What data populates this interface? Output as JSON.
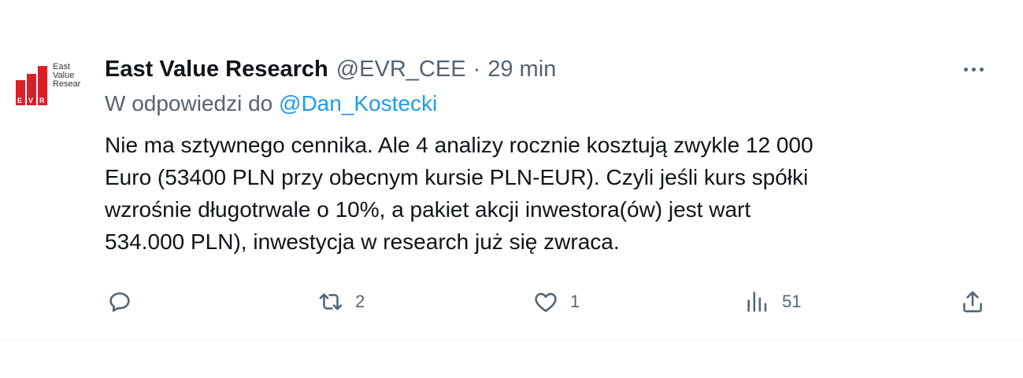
{
  "author": {
    "name": "East Value Research",
    "handle": "@EVR_CEE",
    "separator": "·",
    "time": "29 min",
    "avatar_lines": [
      "East",
      "Value",
      "Resear"
    ],
    "avatar_letters": "EVR"
  },
  "reply_to": {
    "prefix": "W odpowiedzi do",
    "mention": "@Dan_Kostecki"
  },
  "tweet_lines": [
    "Nie ma sztywnego cennika. Ale 4 analizy rocznie kosztują zwykle 12 000",
    "Euro (53400 PLN przy obecnym kursie PLN-EUR). Czyli jeśli kurs spółki",
    "wzrośnie długotrwale o 10%, a pakiet akcji inwestora(ów) jest wart",
    "534.000 PLN), inwestycja w research już się zwraca."
  ],
  "actions": {
    "reply": {
      "icon": "reply-icon",
      "count": ""
    },
    "retweet": {
      "icon": "retweet-icon",
      "count": "2"
    },
    "like": {
      "icon": "heart-icon",
      "count": "1"
    },
    "views": {
      "icon": "views-icon",
      "count": "51"
    },
    "share": {
      "icon": "share-icon",
      "count": ""
    }
  },
  "colors": {
    "text": "#0f1419",
    "secondary": "#536471",
    "link": "#1d9bf0",
    "brand_red": "#d9202a"
  }
}
